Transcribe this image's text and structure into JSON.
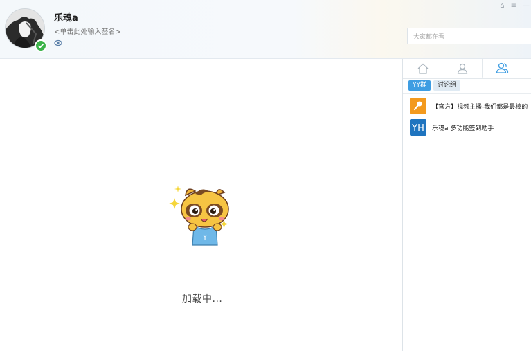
{
  "user": {
    "nickname": "乐魂a",
    "signature": "<单击此处输入签名>"
  },
  "window_controls": [
    "⌂",
    "≡",
    "—"
  ],
  "search": {
    "placeholder": "大家都在看"
  },
  "main": {
    "loading_text": "加载中..."
  },
  "panel": {
    "tabs": [
      {
        "name": "home",
        "icon": "home-icon"
      },
      {
        "name": "contacts",
        "icon": "person-icon"
      },
      {
        "name": "groups",
        "icon": "group-icon",
        "active": true
      }
    ],
    "subtabs": [
      {
        "label": "YY群",
        "active": true
      },
      {
        "label": "讨论组",
        "active": false
      }
    ],
    "groups": [
      {
        "label": "【官方】视频主播-我们都是最棒的",
        "icon": "microphone-icon",
        "color": "#f39a1e"
      },
      {
        "label": "乐魂a 多功能签到助手",
        "icon": "yh-logo-icon",
        "color": "#1f74bf"
      }
    ]
  },
  "colors": {
    "accent": "#3e9de2",
    "online": "#3cb34a"
  }
}
